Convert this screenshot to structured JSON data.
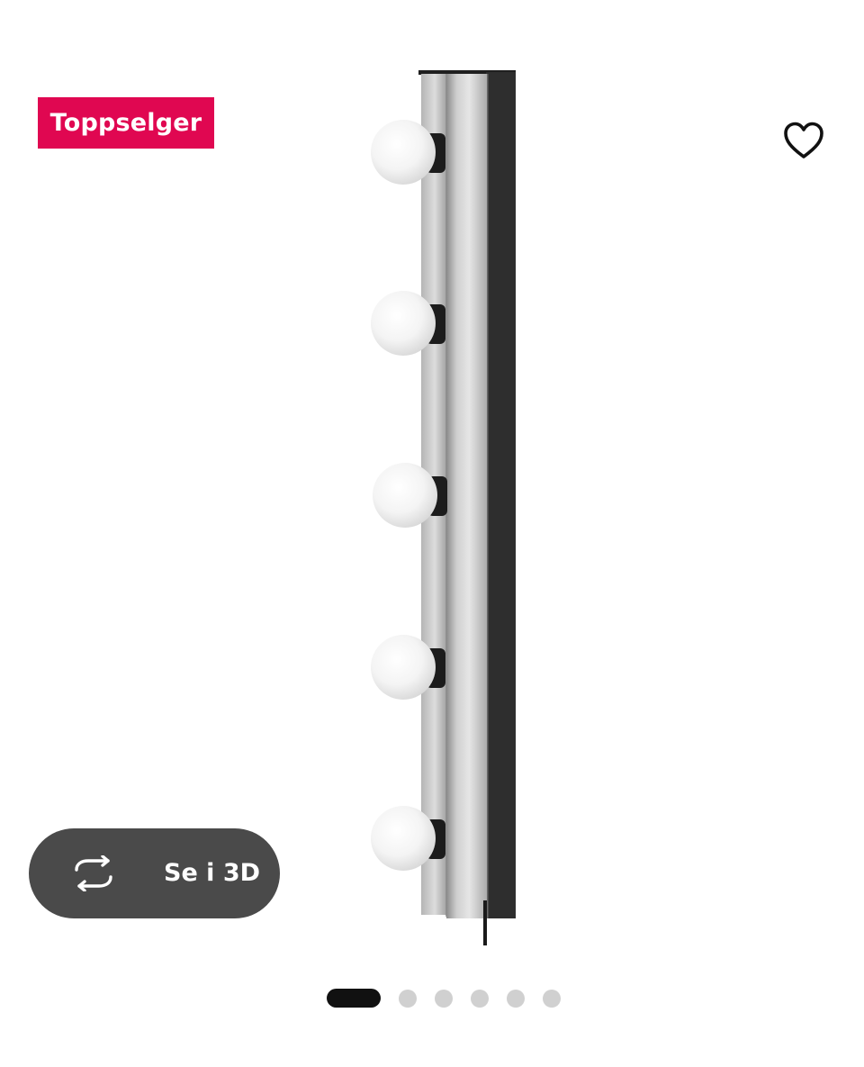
{
  "badge": {
    "label": "Toppselger",
    "color": "#e00751"
  },
  "favorite": {
    "icon": "heart-outline-icon"
  },
  "view_3d": {
    "label": "Se i 3D",
    "icon": "rotate-3d-icon"
  },
  "carousel": {
    "total_images": 6,
    "active_index": 1
  }
}
